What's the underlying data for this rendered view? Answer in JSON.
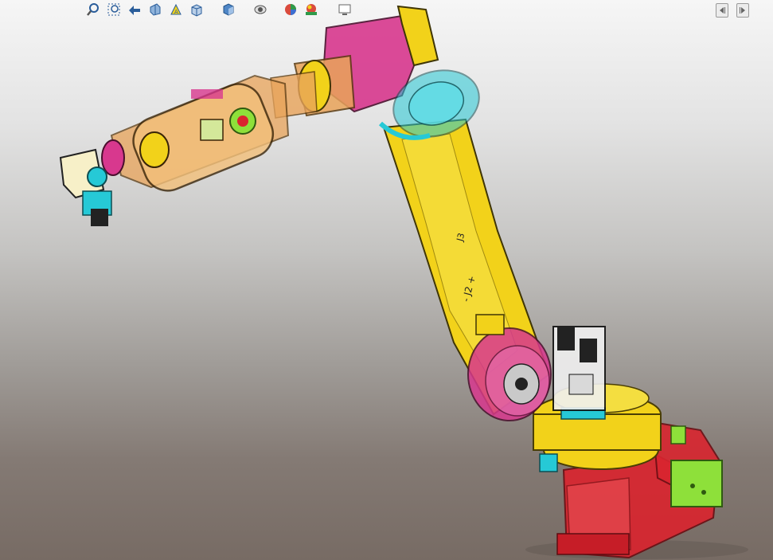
{
  "toolbar": {
    "items": [
      {
        "name": "zoom-to-fit-icon",
        "color": "#2a5d9a"
      },
      {
        "name": "zoom-to-area-icon",
        "color": "#2a5d9a"
      },
      {
        "name": "previous-view-icon",
        "color": "#2a5d9a"
      },
      {
        "name": "section-view-icon",
        "color": "#2a5d9a"
      },
      {
        "name": "dynamic-annotation-views-icon",
        "color": "#2a5d9a"
      },
      {
        "name": "view-orientation-icon",
        "color": "#2a5d9a"
      },
      {
        "name": "display-style-icon",
        "color": "#4f86c6"
      },
      {
        "name": "hide-show-items-icon",
        "color": "#555555"
      },
      {
        "name": "edit-appearance-icon",
        "color": "#d94b3d"
      },
      {
        "name": "apply-scene-icon",
        "color": "#2f9a4a"
      },
      {
        "name": "view-settings-icon",
        "color": "#666666"
      }
    ]
  },
  "pane_controls": [
    {
      "name": "collapse-left-icon"
    },
    {
      "name": "expand-right-icon"
    }
  ],
  "model": {
    "axis_labels": {
      "j3_label": "J3",
      "j2_label": "- J2 +"
    },
    "colors": {
      "yellow": "#f2d21a",
      "red": "#d9252f",
      "magenta": "#d8388e",
      "cyan": "#26c9d6",
      "green": "#8ee03a",
      "orange": "#e9a45a"
    }
  }
}
